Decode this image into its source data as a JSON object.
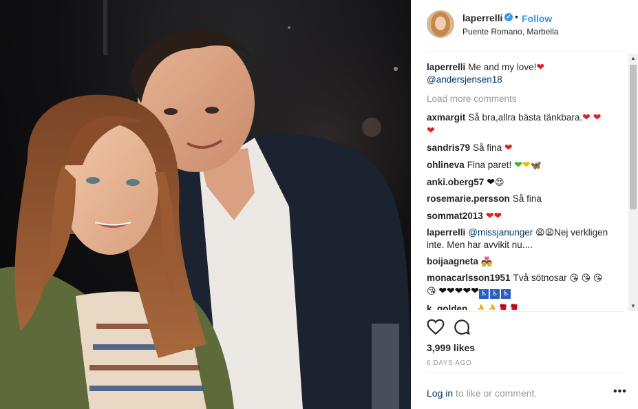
{
  "post": {
    "author": "laperrelli",
    "verified_symbol": "✔",
    "separator": "•",
    "follow_label": "Follow",
    "location": "Puente Romano, Marbella",
    "caption_user": "laperrelli",
    "caption_text": "Me and my love!",
    "caption_mention": "@andersjensen18",
    "load_more": "Load more comments",
    "likes": "3,999 likes",
    "time": "6 DAYS AGO"
  },
  "comments": [
    {
      "user": "axmargit",
      "text": "Så bra,allra bästa tänkbara."
    },
    {
      "user": "sandris79",
      "text": "Så fina"
    },
    {
      "user": "ohlineva",
      "text": "Fina paret!"
    },
    {
      "user": "anki.oberg57",
      "text": ""
    },
    {
      "user": "rosemarie.persson",
      "text": "Så fina"
    },
    {
      "user": "sommat2013",
      "text": ""
    },
    {
      "user": "laperrelli",
      "mention": "@missjanunger",
      "text": "Nej verkligen inte. Men har avvikit nu...."
    },
    {
      "user": "boijaagneta",
      "text": ""
    },
    {
      "user": "monacarlsson1951",
      "text": "Två sötnosar"
    },
    {
      "user": "k_golden_",
      "text": ""
    }
  ],
  "footer": {
    "login_link": "Log in",
    "login_rest": " to like or comment.",
    "more_label": "•••"
  },
  "icons": {
    "like": "heart-outline-icon",
    "comment": "comment-bubble-icon",
    "more": "more-options-icon",
    "verified": "verified-badge-icon"
  },
  "colors": {
    "link": "#3897f0",
    "mention": "#003569",
    "muted": "#999999",
    "heart": "#e0201e"
  }
}
